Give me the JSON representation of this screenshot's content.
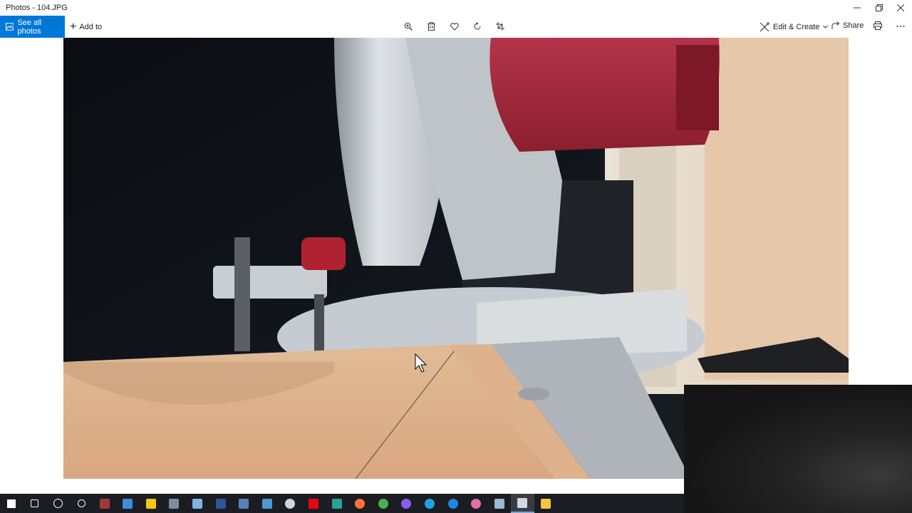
{
  "window": {
    "title": "Photos - 104.JPG"
  },
  "toolbar": {
    "see_all_label": "See all photos",
    "add_to_label": "Add to",
    "edit_create_label": "Edit & Create",
    "share_label": "Share",
    "icons": [
      "zoom-icon",
      "delete-icon",
      "favorite-icon",
      "rotate-icon",
      "crop-icon",
      "print-icon",
      "more-icon"
    ]
  },
  "colors": {
    "accent": "#0078d7",
    "taskbar": "#1c1d22",
    "saw_red": "#9c2634",
    "plywood": "#d9b08a"
  },
  "taskbar": {
    "items": [
      {
        "name": "start-icon",
        "color": "#ffffff"
      },
      {
        "name": "search-icon",
        "color": "#ffffff"
      },
      {
        "name": "cortana-icon",
        "color": "#ffffff"
      },
      {
        "name": "task-view-icon",
        "color": "#ffffff"
      },
      {
        "name": "access-icon",
        "color": "#a4373a"
      },
      {
        "name": "store-icon",
        "color": "#3b8fd8"
      },
      {
        "name": "sticky-notes-icon",
        "color": "#f2c811"
      },
      {
        "name": "file-manager-icon",
        "color": "#7a8ea0"
      },
      {
        "name": "bell-icon",
        "color": "#7fb2e5"
      },
      {
        "name": "word-icon",
        "color": "#2b579a"
      },
      {
        "name": "save-icon",
        "color": "#5a7fb5"
      },
      {
        "name": "app-icon",
        "color": "#4a9ad4"
      },
      {
        "name": "swirl-icon",
        "color": "#cfd6dd"
      },
      {
        "name": "netflix-icon",
        "color": "#e50914"
      },
      {
        "name": "screen-icon",
        "color": "#2aa198"
      },
      {
        "name": "firefox-icon",
        "color": "#ff7139"
      },
      {
        "name": "chrome-icon",
        "color": "#4caf50"
      },
      {
        "name": "purple-app-icon",
        "color": "#8a5cf5"
      },
      {
        "name": "ie-icon",
        "color": "#1ea1e8"
      },
      {
        "name": "edge-icon",
        "color": "#1e88e5"
      },
      {
        "name": "itunes-icon",
        "color": "#e06fa8"
      },
      {
        "name": "calculator-icon",
        "color": "#9fb8cf"
      },
      {
        "name": "photos-icon",
        "color": "#cfd8e3"
      },
      {
        "name": "folder-icon",
        "color": "#f4c542"
      }
    ],
    "active_index": 22
  }
}
